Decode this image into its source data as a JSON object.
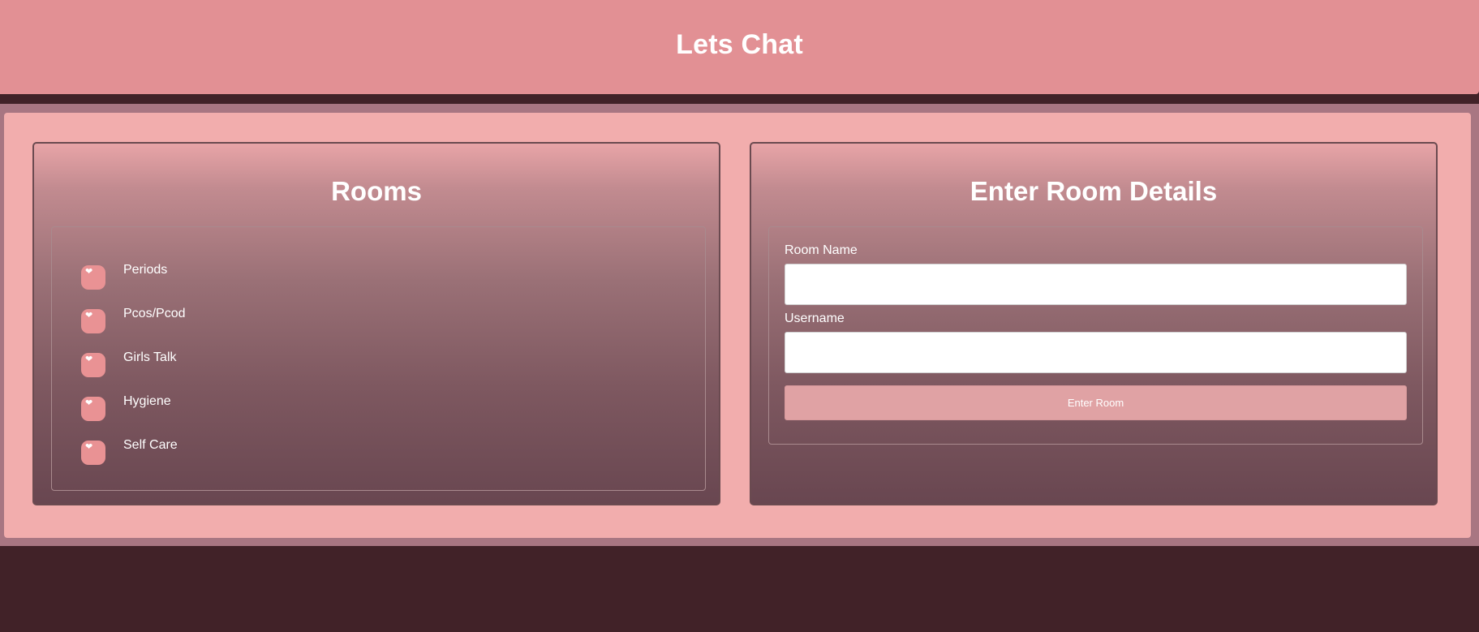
{
  "header": {
    "title": "Lets Chat"
  },
  "rooms": {
    "title": "Rooms",
    "items": [
      {
        "label": "Periods",
        "icon": "heart-icon"
      },
      {
        "label": "Pcos/Pcod",
        "icon": "heart-icon"
      },
      {
        "label": "Girls Talk",
        "icon": "heart-icon"
      },
      {
        "label": "Hygiene",
        "icon": "heart-icon"
      },
      {
        "label": "Self Care",
        "icon": "heart-icon"
      }
    ]
  },
  "form": {
    "title": "Enter Room Details",
    "room_name_label": "Room Name",
    "room_name_value": "",
    "username_label": "Username",
    "username_value": "",
    "submit_label": "Enter Room"
  },
  "colors": {
    "header_bg": "#e29094",
    "page_bg": "#412228",
    "panel_bg": "#f2adad",
    "room_icon_bg": "#e99294",
    "button_bg": "#e0a2a4"
  }
}
